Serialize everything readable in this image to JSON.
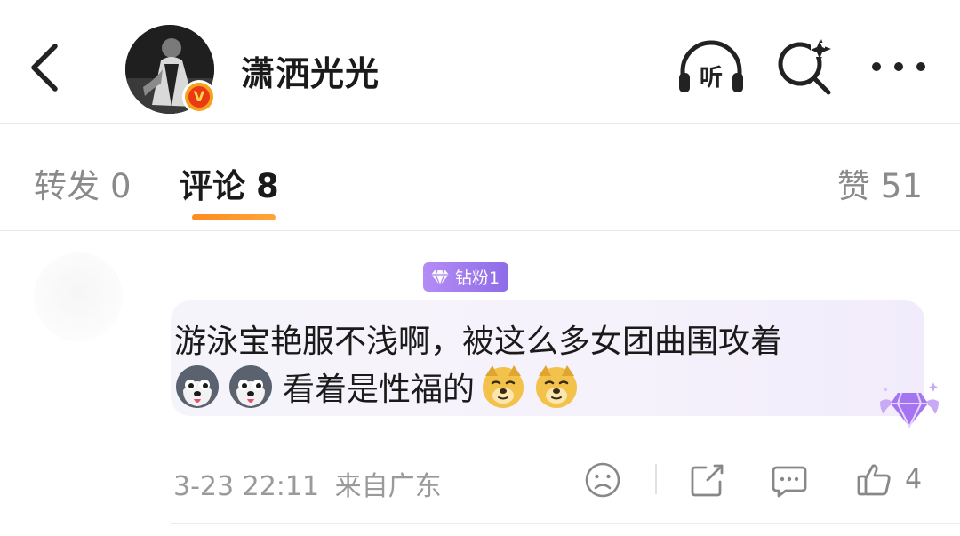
{
  "header": {
    "username": "潇洒光光",
    "icons": [
      "back-arrow-icon",
      "verified-v-icon",
      "listen-headphones-icon",
      "search-sparkle-icon",
      "more-dots-icon"
    ],
    "listen_label": "听",
    "verified_label": "V"
  },
  "tabs": [
    {
      "label": "转发",
      "count": "0",
      "active": false
    },
    {
      "label": "评论",
      "count": "8",
      "active": true
    },
    {
      "label": "赞",
      "count": "51",
      "active": false
    }
  ],
  "comment": {
    "fan_badge": "钻粉1",
    "text_line1": "游泳宝艳服不浅啊，被这么多女团曲围攻着",
    "text_line2": "看着是性福的",
    "emojis_before": [
      "husky-emoji",
      "husky-emoji"
    ],
    "emojis_after": [
      "doge-emoji",
      "doge-emoji"
    ],
    "time": "3-23 22:11",
    "location": "来自广东",
    "like_count": "4"
  },
  "colors": {
    "tab_underline": "#ff8a1e",
    "fan_badge": "#9b78ec",
    "verified": "#ea3a14",
    "bubble": "#f5f2fb"
  }
}
